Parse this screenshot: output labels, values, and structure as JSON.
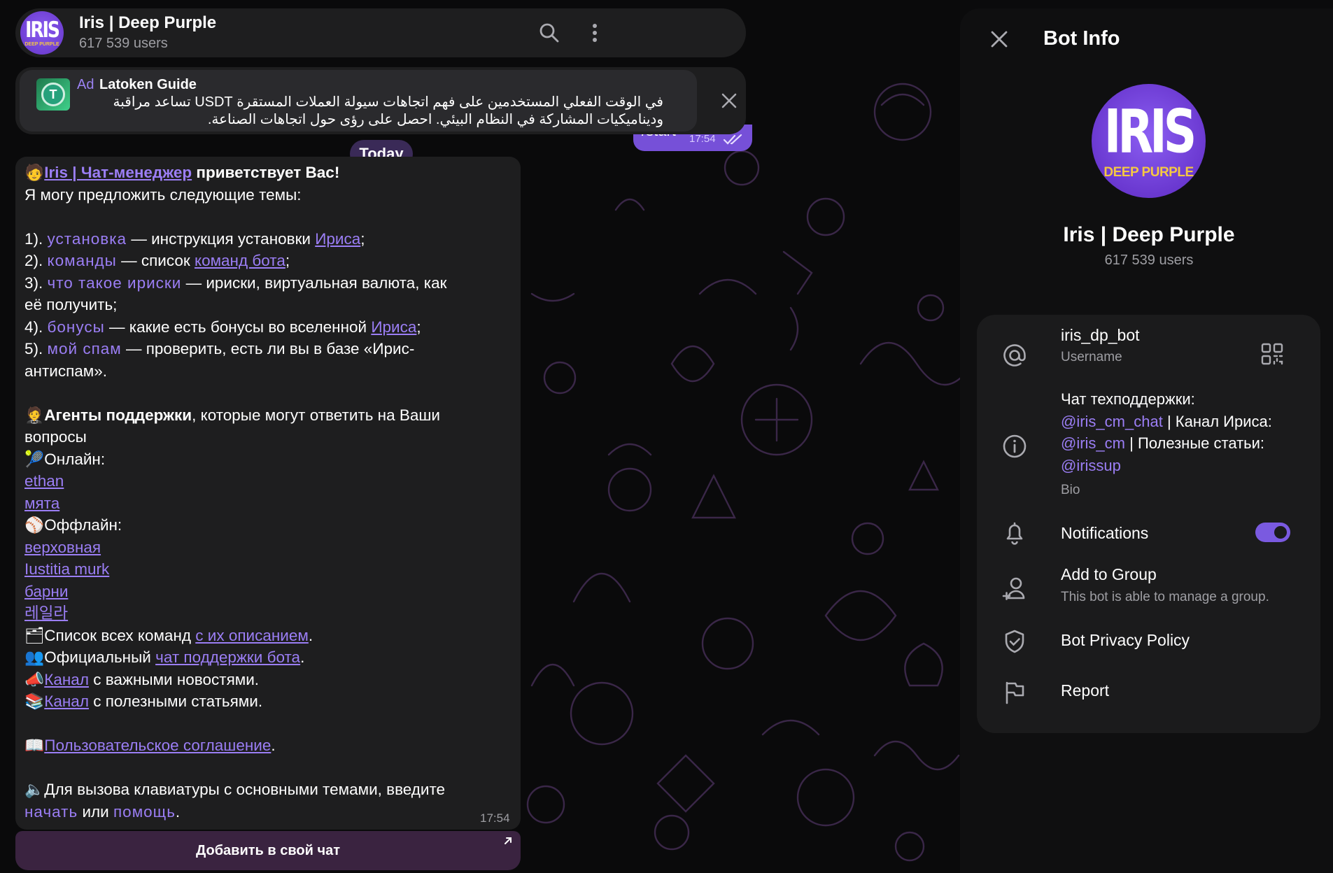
{
  "chat": {
    "title": "Iris | Deep Purple",
    "subtitle": "617 539 users",
    "avatar_text": "IRIS",
    "avatar_subtext": "DEEP PURPLE"
  },
  "ad": {
    "label": "Ad",
    "title": "Latoken Guide",
    "text": "في الوقت الفعلي المستخدمين على فهم اتجاهات سيولة العملات المستقرة USDT تساعد مراقبة وديناميكيات المشاركة في النظام البيئي. احصل على رؤى حول اتجاهات الصناعة."
  },
  "outgoing": {
    "text": "/start",
    "time": "17:54"
  },
  "date_chip": "Today",
  "message": {
    "greet_link": "Iris | Чат-менеджер",
    "greet_rest": " приветствует Вас!",
    "intro": "Я могу предложить следующие темы:",
    "topics": [
      {
        "num": "1). ",
        "cmd": "установка",
        "mid": " — инструкция установки ",
        "link": "Ириса",
        "end": ";"
      },
      {
        "num": "2). ",
        "cmd": "команды",
        "mid": " — список ",
        "link": "команд бота",
        "end": ";"
      },
      {
        "num": "3). ",
        "cmd": "что такое ириски",
        "mid": " — ириски, виртуальная валюта, как",
        "link": "",
        "end": ""
      },
      {
        "num": "4). ",
        "cmd": "бонусы",
        "mid": " — какие есть бонусы во вселенной ",
        "link": "Ириса",
        "end": ";"
      },
      {
        "num": "5). ",
        "cmd": "мой спам",
        "mid": " — проверить, есть ли вы в базе «Ирис-",
        "link": "",
        "end": ""
      }
    ],
    "topic3_cont": "её получить;",
    "topic5_cont": "антиспам».",
    "agents_bold": "Агенты поддержки",
    "agents_rest": ", которые могут ответить на Ваши",
    "agents_cont": "вопросы",
    "online_label": "Онлайн:",
    "online": [
      "ethan",
      "мята"
    ],
    "offline_label": "Оффлайн:",
    "offline": [
      "верховная",
      "Iustitia murk",
      "барни",
      "레일라"
    ],
    "commands_text": "Список всех команд ",
    "commands_link": "с их описанием",
    "official_text": "Официальный ",
    "official_link": "чат поддержки бота",
    "channel1_link": "Канал",
    "channel1_text": " с важными новостями.",
    "channel2_link": "Канал",
    "channel2_text": " с полезными статьями.",
    "agreement_link": "Пользовательское соглашение",
    "keyboard_text": "Для вызова клавиатуры с основными темами, введите",
    "start_cmd": "начать",
    "or_text": " или ",
    "help_cmd": "помощь",
    "dot": ".",
    "time": "17:54"
  },
  "inline_button": {
    "label": "Добавить в свой чат"
  },
  "panel": {
    "title": "Bot Info",
    "name": "Iris | Deep Purple",
    "subtitle": "617 539 users",
    "avatar_text": "IRIS",
    "avatar_subtext": "DEEP PURPLE",
    "username": "iris_dp_bot",
    "username_label": "Username",
    "bio_l1": "Чат техподдержки:",
    "bio_h1": "@iris_cm_chat",
    "bio_t2": " | Канал Ириса:",
    "bio_h2": "@iris_cm",
    "bio_t3": " | Полезные статьи:",
    "bio_h3": "@irissup",
    "bio_label": "Bio",
    "notifications": "Notifications",
    "notifications_on": true,
    "add_group": "Add to Group",
    "add_group_sub": "This bot is able to manage a group.",
    "privacy": "Bot Privacy Policy",
    "report": "Report"
  },
  "colors": {
    "accent": "#7a5ae0",
    "link": "#9b7ef5",
    "bubble": "#1e1e1f",
    "panel": "#0f0f10"
  }
}
